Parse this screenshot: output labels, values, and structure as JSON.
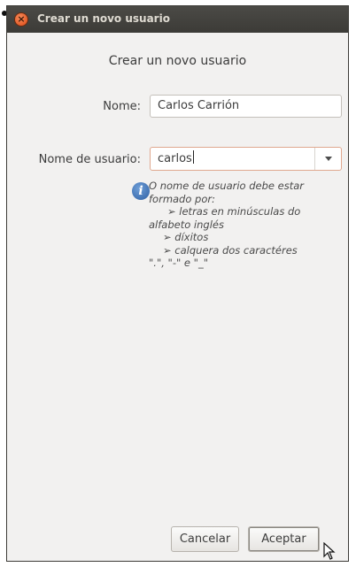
{
  "window": {
    "title": "Crear un novo usuario"
  },
  "form": {
    "header": "Crear un novo usuario",
    "name_label": "Nome:",
    "name_value": "Carlos Carrión",
    "username_label": "Nome de usuario:",
    "username_value": "carlos"
  },
  "hint": {
    "line1": "O nome de usuario debe estar",
    "line2": "formado por:",
    "line3": "➢ letras en minúsculas do",
    "line4": "alfabeto inglés",
    "line5": "➢ díxitos",
    "line6": "➢ calquera dos caractéres",
    "line7": "\".\", \"-\" e \"_\""
  },
  "buttons": {
    "cancel": "Cancelar",
    "accept": "Aceptar"
  },
  "icons": [
    "close-icon",
    "info-icon",
    "dropdown-arrow-icon",
    "mouse-pointer-icon"
  ]
}
